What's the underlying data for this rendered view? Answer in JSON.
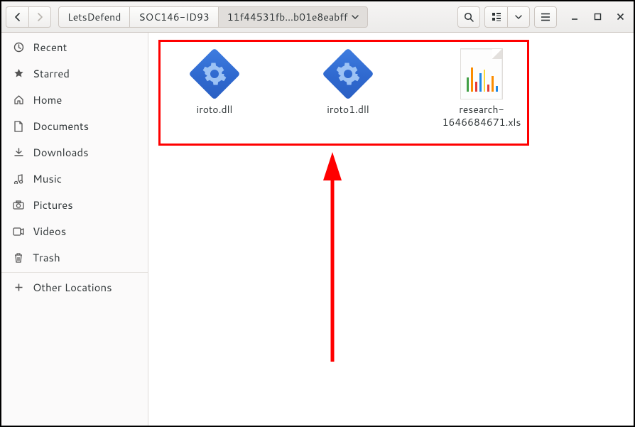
{
  "pathbar": [
    "LetsDefend",
    "SOC146-ID93",
    "11f44531fb…b01e8eabff"
  ],
  "sidebar": {
    "items": [
      {
        "label": "Recent",
        "icon": "clock"
      },
      {
        "label": "Starred",
        "icon": "star"
      },
      {
        "label": "Home",
        "icon": "home"
      },
      {
        "label": "Documents",
        "icon": "doc"
      },
      {
        "label": "Downloads",
        "icon": "download"
      },
      {
        "label": "Music",
        "icon": "music"
      },
      {
        "label": "Pictures",
        "icon": "camera"
      },
      {
        "label": "Videos",
        "icon": "video"
      },
      {
        "label": "Trash",
        "icon": "trash"
      }
    ],
    "other": "Other Locations"
  },
  "files": [
    {
      "name": "iroto.dll",
      "type": "dll"
    },
    {
      "name": "iroto1.dll",
      "type": "dll"
    },
    {
      "name": "research-1646684671.xls",
      "type": "xls"
    }
  ]
}
